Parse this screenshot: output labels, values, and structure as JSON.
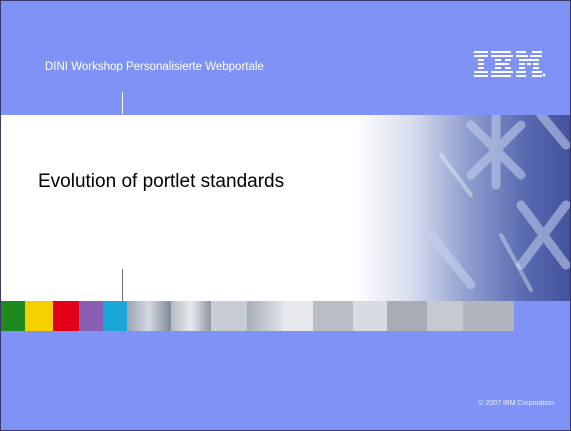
{
  "header": {
    "workshop_label": "DINI Workshop Personalisierte Webportale",
    "logo_text": "IBM"
  },
  "slide": {
    "title": "Evolution of portlet standards"
  },
  "footer": {
    "copyright": "© 2007 IBM Corporation"
  },
  "colors": {
    "background": "#7f93f7",
    "strip": [
      "#1e8a1e",
      "#f5d000",
      "#e0001a",
      "#8a5fb3",
      "#1aa6d6"
    ]
  }
}
